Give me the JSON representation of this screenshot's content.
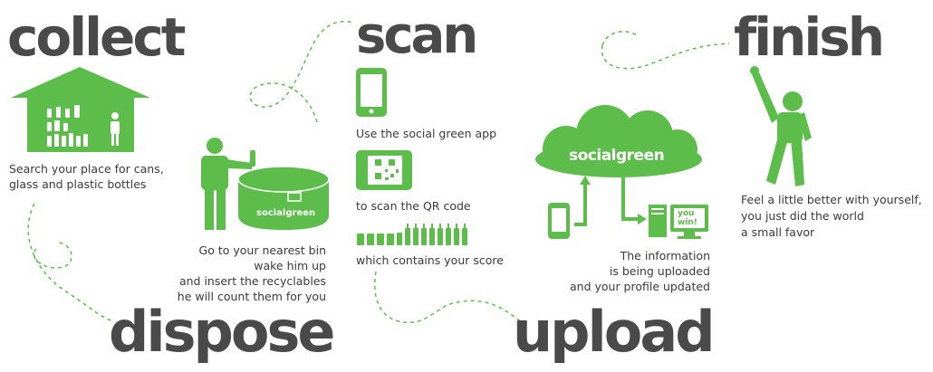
{
  "steps": {
    "collect": {
      "title": "collect",
      "line1": "Search your place for cans,",
      "line2": "glass and plastic bottles"
    },
    "dispose": {
      "title": "dispose",
      "line1": "Go to your nearest bin",
      "line2": "wake him up",
      "line3": "and insert the recyclables",
      "line4": "he will count them for you",
      "bin_label": "socialgreen"
    },
    "scan": {
      "title": "scan",
      "line1": "Use the social green app",
      "line2": "to scan the QR code",
      "line3": "which contains your score"
    },
    "upload": {
      "title": "upload",
      "line1": "The information",
      "line2": "is being uploaded",
      "line3": "and your profile updated",
      "cloud_label": "socialgreen",
      "screen_line1": "you",
      "screen_line2": "win!"
    },
    "finish": {
      "title": "finish",
      "line1": "Feel a little better with yourself,",
      "line2": "you just did the world",
      "line3": "a small favor"
    }
  },
  "colors": {
    "green": "#5cbd4a",
    "dark_text": "#4a4a4a",
    "body_text": "#3a3a3a",
    "background": "#ffffff"
  },
  "icons": [
    "house-icon",
    "person-icon",
    "recycling-bin-icon",
    "phone-icon",
    "qr-scanner-icon",
    "bottles-icon",
    "cloud-icon",
    "computer-icon",
    "cheering-person-icon"
  ]
}
